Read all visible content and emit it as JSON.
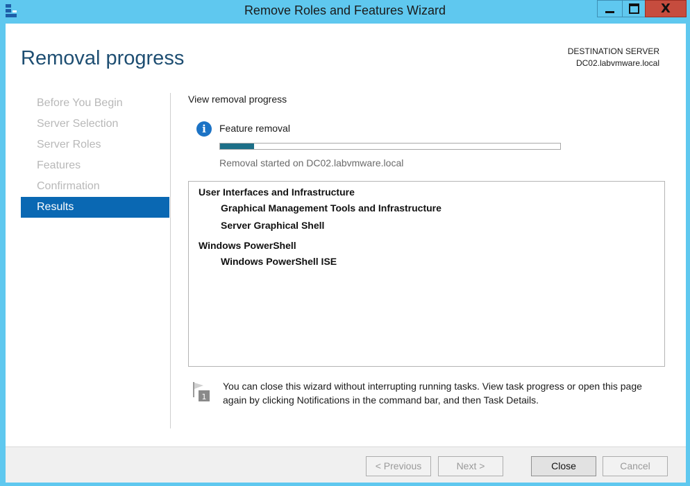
{
  "window": {
    "title": "Remove Roles and Features Wizard",
    "close_glyph": "X"
  },
  "header": {
    "page_title": "Removal progress",
    "destination_label": "DESTINATION SERVER",
    "destination_server": "DC02.labvmware.local"
  },
  "nav": {
    "items": [
      {
        "label": "Before You Begin",
        "active": false
      },
      {
        "label": "Server Selection",
        "active": false
      },
      {
        "label": "Server Roles",
        "active": false
      },
      {
        "label": "Features",
        "active": false
      },
      {
        "label": "Confirmation",
        "active": false
      },
      {
        "label": "Results",
        "active": true
      }
    ]
  },
  "main": {
    "subheading": "View removal progress",
    "progress": {
      "label": "Feature removal",
      "icon": "info-icon",
      "percent": 10,
      "status": "Removal started on DC02.labvmware.local"
    },
    "features": [
      {
        "group": "User Interfaces and Infrastructure",
        "items": [
          "Graphical Management Tools and Infrastructure",
          "Server Graphical Shell"
        ]
      },
      {
        "group": "Windows PowerShell",
        "items": [
          "Windows PowerShell ISE"
        ]
      }
    ],
    "note": {
      "icon": "notification-flag-icon",
      "badge": "1",
      "text": "You can close this wizard without interrupting running tasks. View task progress or open this page again by clicking Notifications in the command bar, and then Task Details."
    }
  },
  "footer": {
    "previous": "< Previous",
    "next": "Next >",
    "close": "Close",
    "cancel": "Cancel"
  },
  "colors": {
    "accent": "#0a68b3",
    "title_bar": "#5fc8ef",
    "progress_fill": "#1c6f88"
  }
}
